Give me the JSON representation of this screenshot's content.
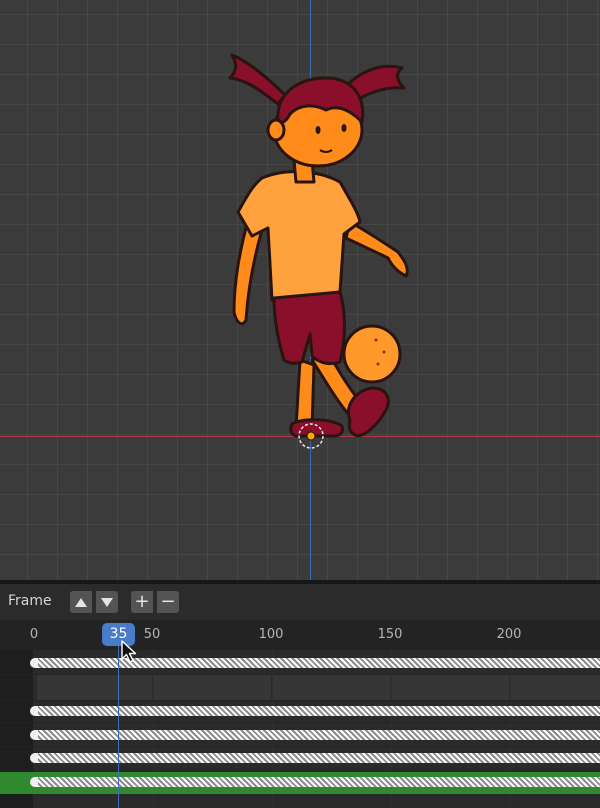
{
  "timeline": {
    "frame_label": "Frame",
    "current_frame": "35",
    "ruler_ticks": [
      {
        "label": "0",
        "frame": 0
      },
      {
        "label": "50",
        "frame": 50
      },
      {
        "label": "100",
        "frame": 100
      },
      {
        "label": "150",
        "frame": 150
      },
      {
        "label": "200",
        "frame": 200
      }
    ],
    "buttons": {
      "frame_up": "triangle-up-icon",
      "frame_down": "triangle-down-icon",
      "add": "+",
      "remove": "−"
    }
  },
  "colors": {
    "viewport_bg": "#3b3b3b",
    "x_axis": "#b23a48",
    "y_axis": "#3c6bb0",
    "current_frame_badge": "#4a7bc8",
    "active_track": "#2f8a2f",
    "skin": "#ff8c1a",
    "shirt": "#ffa13d",
    "hair_and_shorts": "#8a0f2b"
  }
}
